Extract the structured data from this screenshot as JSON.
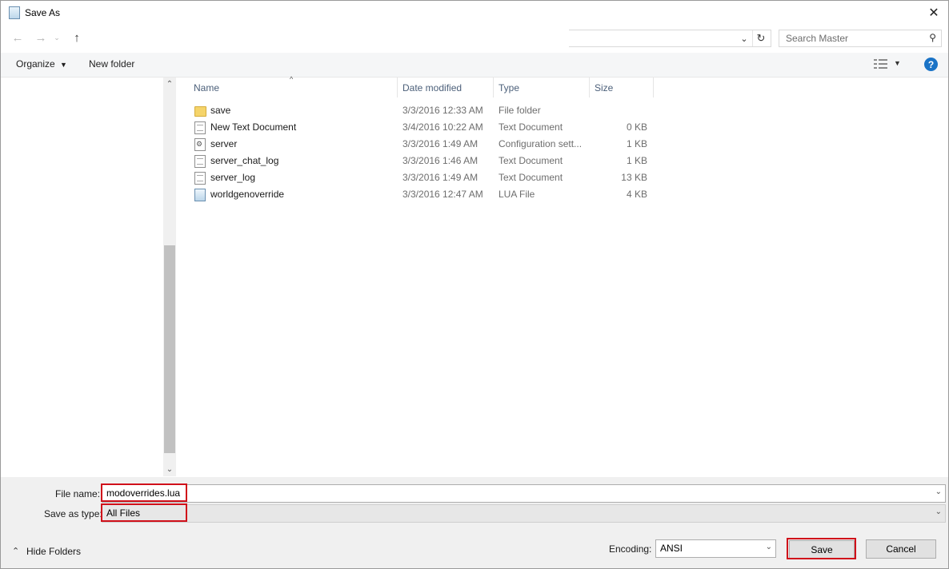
{
  "window": {
    "title": "Save As",
    "close_symbol": "✕"
  },
  "nav": {
    "search_placeholder": "Search Master"
  },
  "toolbar": {
    "organize_label": "Organize",
    "new_folder_label": "New folder"
  },
  "columns": {
    "name": "Name",
    "date": "Date modified",
    "type": "Type",
    "size": "Size"
  },
  "files": [
    {
      "name": "save",
      "date": "3/3/2016 12:33 AM",
      "type": "File folder",
      "size": "",
      "icon": "folder"
    },
    {
      "name": "New Text Document",
      "date": "3/4/2016 10:22 AM",
      "type": "Text Document",
      "size": "0 KB",
      "icon": "doc"
    },
    {
      "name": "server",
      "date": "3/3/2016 1:49 AM",
      "type": "Configuration sett...",
      "size": "1 KB",
      "icon": "cfg"
    },
    {
      "name": "server_chat_log",
      "date": "3/3/2016 1:46 AM",
      "type": "Text Document",
      "size": "1 KB",
      "icon": "doc"
    },
    {
      "name": "server_log",
      "date": "3/3/2016 1:49 AM",
      "type": "Text Document",
      "size": "13 KB",
      "icon": "doc"
    },
    {
      "name": "worldgenoverride",
      "date": "3/3/2016 12:47 AM",
      "type": "LUA File",
      "size": "4 KB",
      "icon": "lua"
    }
  ],
  "form": {
    "filename_label": "File name:",
    "filename_value": "modoverrides.lua",
    "savetype_label": "Save as type:",
    "savetype_value": "All Files",
    "encoding_label": "Encoding:",
    "encoding_value": "ANSI"
  },
  "footer": {
    "hide_folders_label": "Hide Folders",
    "save_label": "Save",
    "cancel_label": "Cancel"
  },
  "colors": {
    "highlight": "#d0101a",
    "help_blue": "#1a73c6",
    "header_text": "#4c607a"
  }
}
